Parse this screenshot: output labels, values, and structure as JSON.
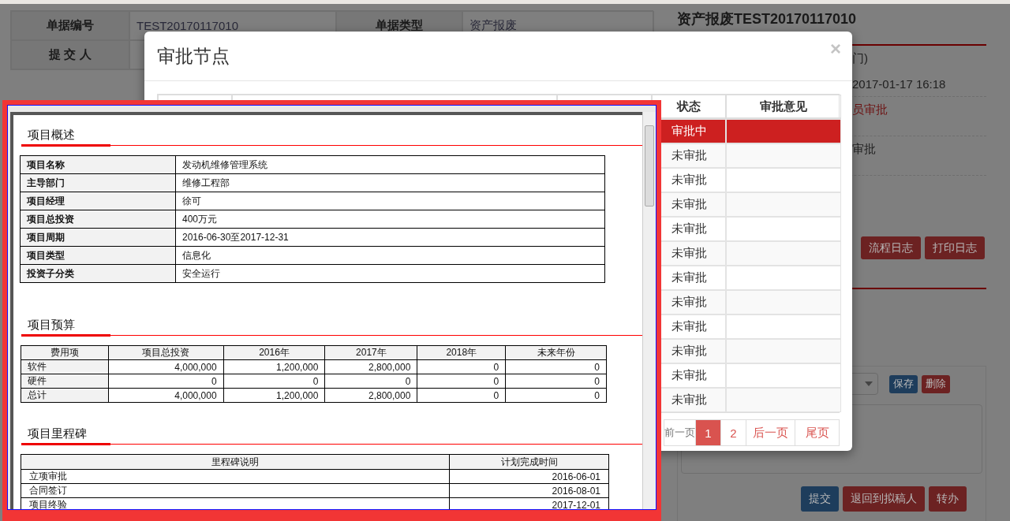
{
  "background_page": {
    "info_table": {
      "rows": [
        {
          "cells": [
            {
              "kind": "label",
              "text": "单据编号"
            },
            {
              "kind": "value",
              "text": "TEST20170117010"
            },
            {
              "kind": "label",
              "text": "单据类型"
            },
            {
              "kind": "value",
              "text": "资产报废"
            }
          ]
        },
        {
          "cells": [
            {
              "kind": "label",
              "text": "提 交 人"
            }
          ]
        }
      ]
    },
    "side_panel": {
      "title": "资产报废TEST20170117010",
      "info_lines": [
        {
          "kind": "plain",
          "text": "门)"
        },
        {
          "kind": "plain",
          "text": "2017-01-17 16:18"
        },
        {
          "kind": "alert",
          "text": "员审批"
        },
        {
          "kind": "plain",
          "text": "审批"
        }
      ],
      "log_buttons": [
        "流程日志",
        "打印日志"
      ],
      "opinion_actions": [
        {
          "kind": "primary",
          "label": "保存"
        },
        {
          "kind": "danger",
          "label": "删除"
        }
      ],
      "submit_buttons": [
        {
          "kind": "primary",
          "label": "提交"
        },
        {
          "kind": "danger",
          "label": "退回到拟稿人"
        },
        {
          "kind": "danger",
          "label": "转办"
        }
      ]
    }
  },
  "modal": {
    "title": "审批节点",
    "close": "×",
    "table": {
      "columns": [
        "状态",
        "审批意见"
      ],
      "rows": [
        {
          "status": "审批中",
          "selected": true
        },
        {
          "status": "未审批",
          "selected": false
        },
        {
          "status": "未审批",
          "selected": false
        },
        {
          "status": "未审批",
          "selected": false
        },
        {
          "status": "未审批",
          "selected": false
        },
        {
          "status": "未审批",
          "selected": false
        },
        {
          "status": "未审批",
          "selected": false
        },
        {
          "status": "未审批",
          "selected": false
        },
        {
          "status": "未审批",
          "selected": false
        },
        {
          "status": "未审批",
          "selected": false
        },
        {
          "status": "未审批",
          "selected": false
        },
        {
          "status": "未审批",
          "selected": false
        }
      ]
    },
    "pagination": [
      {
        "label": "前一页",
        "selected": false
      },
      {
        "label": "1",
        "selected": true
      },
      {
        "label": "2",
        "selected": false
      },
      {
        "label": "后一页",
        "selected": false
      },
      {
        "label": "尾页",
        "selected": false
      }
    ]
  },
  "document_viewer": {
    "sections": [
      {
        "kind": "key_value",
        "heading": "项目概述",
        "rows": [
          [
            "项目名称",
            "发动机维修管理系统"
          ],
          [
            "主导部门",
            "维修工程部"
          ],
          [
            "项目经理",
            "徐可"
          ],
          [
            "项目总投资",
            "400万元"
          ],
          [
            "项目周期",
            "2016-06-30至2017-12-31"
          ],
          [
            "项目类型",
            "信息化"
          ],
          [
            "投资子分类",
            "安全运行"
          ]
        ]
      },
      {
        "kind": "budget",
        "heading": "项目预算",
        "columns": [
          "费用项",
          "项目总投资",
          "2016年",
          "2017年",
          "2018年",
          "未来年份"
        ],
        "rows": [
          [
            "软件",
            "4,000,000",
            "1,200,000",
            "2,800,000",
            "0",
            "0"
          ],
          [
            "硬件",
            "0",
            "0",
            "0",
            "0",
            "0"
          ],
          [
            "总计",
            "4,000,000",
            "1,200,000",
            "2,800,000",
            "0",
            "0"
          ]
        ]
      },
      {
        "kind": "milestones",
        "heading": "项目里程碑",
        "columns": [
          "里程碑说明",
          "计划完成时间"
        ],
        "rows": [
          [
            "立项审批",
            "2016-06-01"
          ],
          [
            "合同签订",
            "2016-08-01"
          ],
          [
            "项目终验",
            "2017-12-01"
          ]
        ]
      }
    ]
  }
}
